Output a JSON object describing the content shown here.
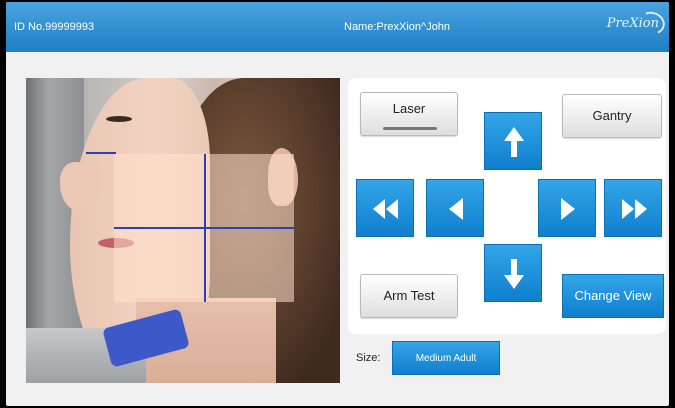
{
  "header": {
    "id_text": "ID No.99999993",
    "name_text": "Name:PrexXion^John",
    "logo_text": "PreXion"
  },
  "controls": {
    "laser_label": "Laser",
    "gantry_label": "Gantry",
    "arm_test_label": "Arm Test",
    "change_view_label": "Change View"
  },
  "size": {
    "label": "Size:",
    "value": "Medium Adult"
  },
  "colors": {
    "header": "#2b8ed3",
    "button_blue": "#1a8ad6",
    "laser_line": "#2e40b4"
  },
  "icons": {
    "up": "arrow-up-icon",
    "down": "arrow-down-icon",
    "left": "arrow-left-icon",
    "right": "arrow-right-icon",
    "fast_left": "double-arrow-left-icon",
    "fast_right": "double-arrow-right-icon"
  }
}
